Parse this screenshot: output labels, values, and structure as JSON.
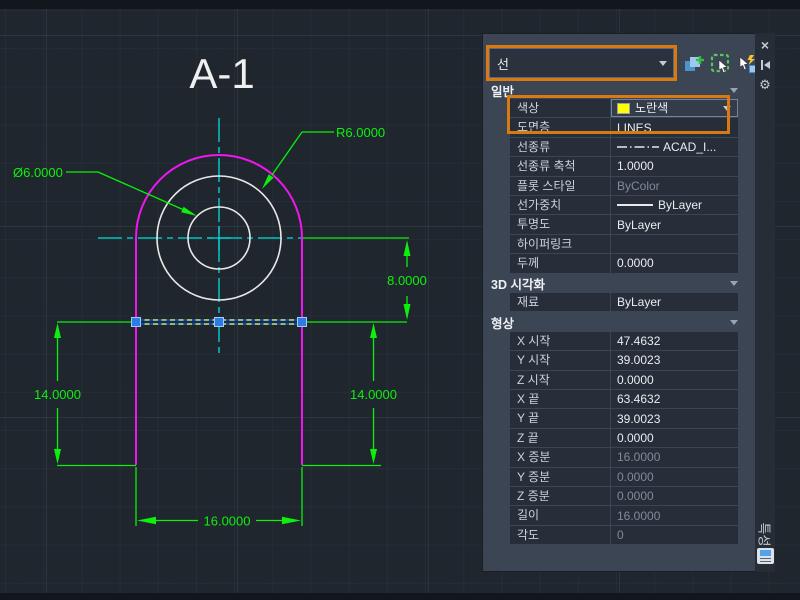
{
  "canvas": {
    "title": "A-1",
    "dimensions": {
      "radius_label": "R6.0000",
      "diameter_label": "Ø6.0000",
      "height_label": "8.0000",
      "left_height_label": "14.0000",
      "right_height_label": "14.0000",
      "width_label": "16.0000"
    },
    "colors": {
      "background": "#20262e",
      "outline": "#ff00ff",
      "dimension": "#0cf00c",
      "centerline": "#00dede",
      "circle": "#e8e8e8",
      "grip": "#2d7ce3",
      "selection_glow": "#1a4a8c"
    }
  },
  "palette": {
    "selector_value": "선",
    "highlight_color": "#d97912",
    "toolbar": {
      "pickadd": "pickadd-toggle",
      "select_objects": "select-objects",
      "quick_select": "quick-select"
    },
    "titlebar": {
      "title": "특성"
    },
    "sections": {
      "general": {
        "title": "일반",
        "rows": [
          {
            "label": "색상",
            "value": "노란색"
          },
          {
            "label": "도면층",
            "value": "LINES"
          },
          {
            "label": "선종류",
            "value": "ACAD_I..."
          },
          {
            "label": "선종류 축척",
            "value": "1.0000"
          },
          {
            "label": "플롯 스타일",
            "value": "ByColor"
          },
          {
            "label": "선가중치",
            "value": "ByLayer"
          },
          {
            "label": "투명도",
            "value": "ByLayer"
          },
          {
            "label": "하이퍼링크",
            "value": ""
          },
          {
            "label": "두께",
            "value": "0.0000"
          }
        ]
      },
      "visual": {
        "title": "3D 시각화",
        "rows": [
          {
            "label": "재료",
            "value": "ByLayer"
          }
        ]
      },
      "geometry": {
        "title": "형상",
        "rows": [
          {
            "label": "X 시작",
            "value": "47.4632"
          },
          {
            "label": "Y 시작",
            "value": "39.0023"
          },
          {
            "label": "Z 시작",
            "value": "0.0000"
          },
          {
            "label": "X 끝",
            "value": "63.4632"
          },
          {
            "label": "Y 끝",
            "value": "39.0023"
          },
          {
            "label": "Z 끝",
            "value": "0.0000"
          },
          {
            "label": "X 증분",
            "value": "16.0000"
          },
          {
            "label": "Y 증분",
            "value": "0.0000"
          },
          {
            "label": "Z 증분",
            "value": "0.0000"
          },
          {
            "label": "길이",
            "value": "16.0000"
          },
          {
            "label": "각도",
            "value": "0"
          }
        ]
      }
    }
  }
}
